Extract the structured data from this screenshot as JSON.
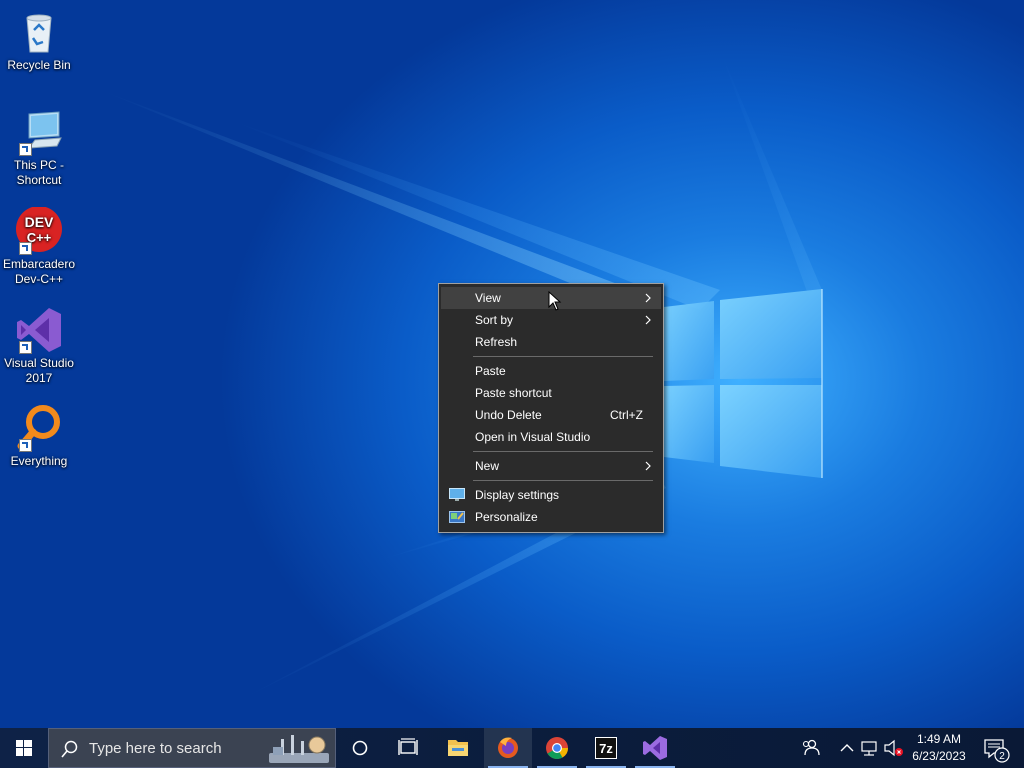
{
  "desktop": {
    "icons": [
      {
        "label": "Recycle Bin",
        "icon": "recycle-bin-icon"
      },
      {
        "label": "This PC - Shortcut",
        "icon": "computer-icon"
      },
      {
        "label": "Embarcadero Dev-C++",
        "icon": "devcpp-icon",
        "badge_text": "DEV C++"
      },
      {
        "label": "Visual Studio 2017",
        "icon": "visual-studio-icon"
      },
      {
        "label": "Everything",
        "icon": "everything-search-icon"
      }
    ]
  },
  "context_menu": {
    "items": [
      {
        "label": "View",
        "submenu": true,
        "highlighted": true
      },
      {
        "label": "Sort by",
        "submenu": true
      },
      {
        "label": "Refresh"
      },
      {
        "label": "Paste"
      },
      {
        "label": "Paste shortcut"
      },
      {
        "label": "Undo Delete",
        "shortcut": "Ctrl+Z"
      },
      {
        "label": "Open in Visual Studio"
      },
      {
        "label": "New",
        "submenu": true
      },
      {
        "label": "Display settings",
        "icon": "display-settings-icon"
      },
      {
        "label": "Personalize",
        "icon": "personalize-icon"
      }
    ]
  },
  "taskbar": {
    "search_placeholder": "Type here to search",
    "pinned": [
      {
        "name": "cortana",
        "icon": "cortana-circle-icon"
      },
      {
        "name": "task-view",
        "icon": "task-view-icon"
      },
      {
        "name": "file-explorer",
        "icon": "folder-icon"
      },
      {
        "name": "firefox",
        "icon": "firefox-icon",
        "active": true
      },
      {
        "name": "chrome",
        "icon": "chrome-icon",
        "running": true
      },
      {
        "name": "7-zip",
        "icon": "7zip-icon",
        "running": true,
        "text": "7z"
      },
      {
        "name": "visual-studio",
        "icon": "visual-studio-icon",
        "running": true
      }
    ],
    "tray": {
      "time": "1:49 AM",
      "date": "6/23/2023",
      "notification_count": "2"
    }
  },
  "colors": {
    "menu_bg": "#2b2b2b",
    "menu_hover": "#414141",
    "taskbar_bg": "#0b1d3d",
    "desktop_blue": "#0a5cc8"
  }
}
